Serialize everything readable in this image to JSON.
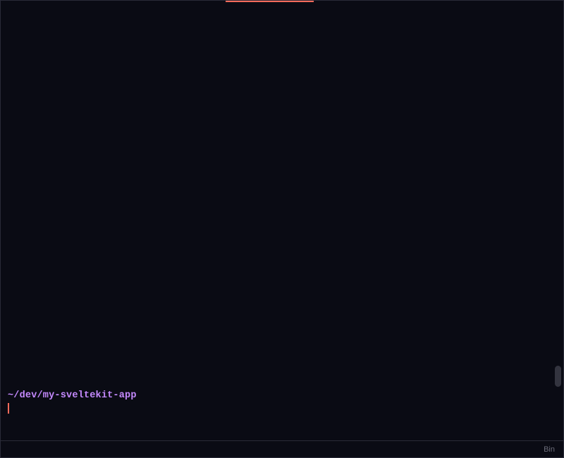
{
  "accent_color": "#ff6b5b",
  "prompt": {
    "cwd": "~/dev/my-sveltekit-app",
    "input_value": ""
  },
  "status_bar": {
    "right_label": "Bin"
  }
}
